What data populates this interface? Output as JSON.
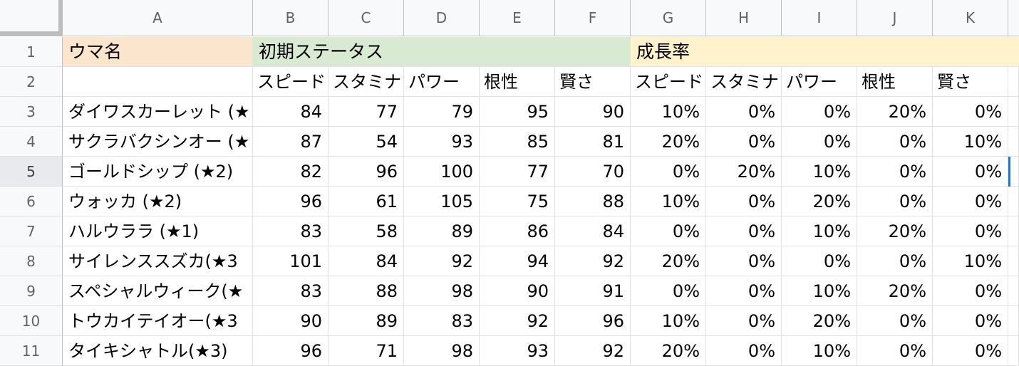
{
  "columns": [
    "A",
    "B",
    "C",
    "D",
    "E",
    "F",
    "G",
    "H",
    "I",
    "J",
    "K"
  ],
  "rows": [
    "1",
    "2",
    "3",
    "4",
    "5",
    "6",
    "7",
    "8",
    "9",
    "10",
    "11"
  ],
  "selected_row": "5",
  "header_row1": {
    "uma_name": "ウマ名",
    "initial_status": "初期ステータス",
    "growth_rate": "成長率"
  },
  "header_row2": [
    "",
    "スピード",
    "スタミナ",
    "パワー",
    "根性",
    "賢さ",
    "スピード",
    "スタミナ",
    "パワー",
    "根性",
    "賢さ"
  ],
  "data_rows": [
    [
      "ダイワスカーレット (★",
      "84",
      "77",
      "79",
      "95",
      "90",
      "10%",
      "0%",
      "0%",
      "20%",
      "0%"
    ],
    [
      "サクラバクシンオー (★",
      "87",
      "54",
      "93",
      "85",
      "81",
      "20%",
      "0%",
      "0%",
      "0%",
      "10%"
    ],
    [
      "ゴールドシップ (★2)",
      "82",
      "96",
      "100",
      "77",
      "70",
      "0%",
      "20%",
      "10%",
      "0%",
      "0%"
    ],
    [
      "ウォッカ (★2)",
      "96",
      "61",
      "105",
      "75",
      "88",
      "10%",
      "0%",
      "20%",
      "0%",
      "0%"
    ],
    [
      "ハルウララ (★1)",
      "83",
      "58",
      "89",
      "86",
      "84",
      "0%",
      "0%",
      "10%",
      "20%",
      "0%"
    ],
    [
      "サイレンススズカ(★3",
      "101",
      "84",
      "92",
      "94",
      "92",
      "20%",
      "0%",
      "0%",
      "0%",
      "10%"
    ],
    [
      "スペシャルウィーク(★",
      "83",
      "88",
      "98",
      "90",
      "91",
      "0%",
      "0%",
      "10%",
      "20%",
      "0%"
    ],
    [
      "トウカイテイオー(★3",
      "90",
      "89",
      "83",
      "92",
      "96",
      "10%",
      "0%",
      "20%",
      "0%",
      "0%"
    ],
    [
      "タイキシャトル(★3)",
      "96",
      "71",
      "98",
      "93",
      "92",
      "20%",
      "0%",
      "10%",
      "0%",
      "0%"
    ]
  ],
  "colors": {
    "name_header_bg": "#fce5cd",
    "initial_header_bg": "#d9ead3",
    "growth_header_bg": "#fff2cc",
    "selection": "#1a73e8"
  }
}
